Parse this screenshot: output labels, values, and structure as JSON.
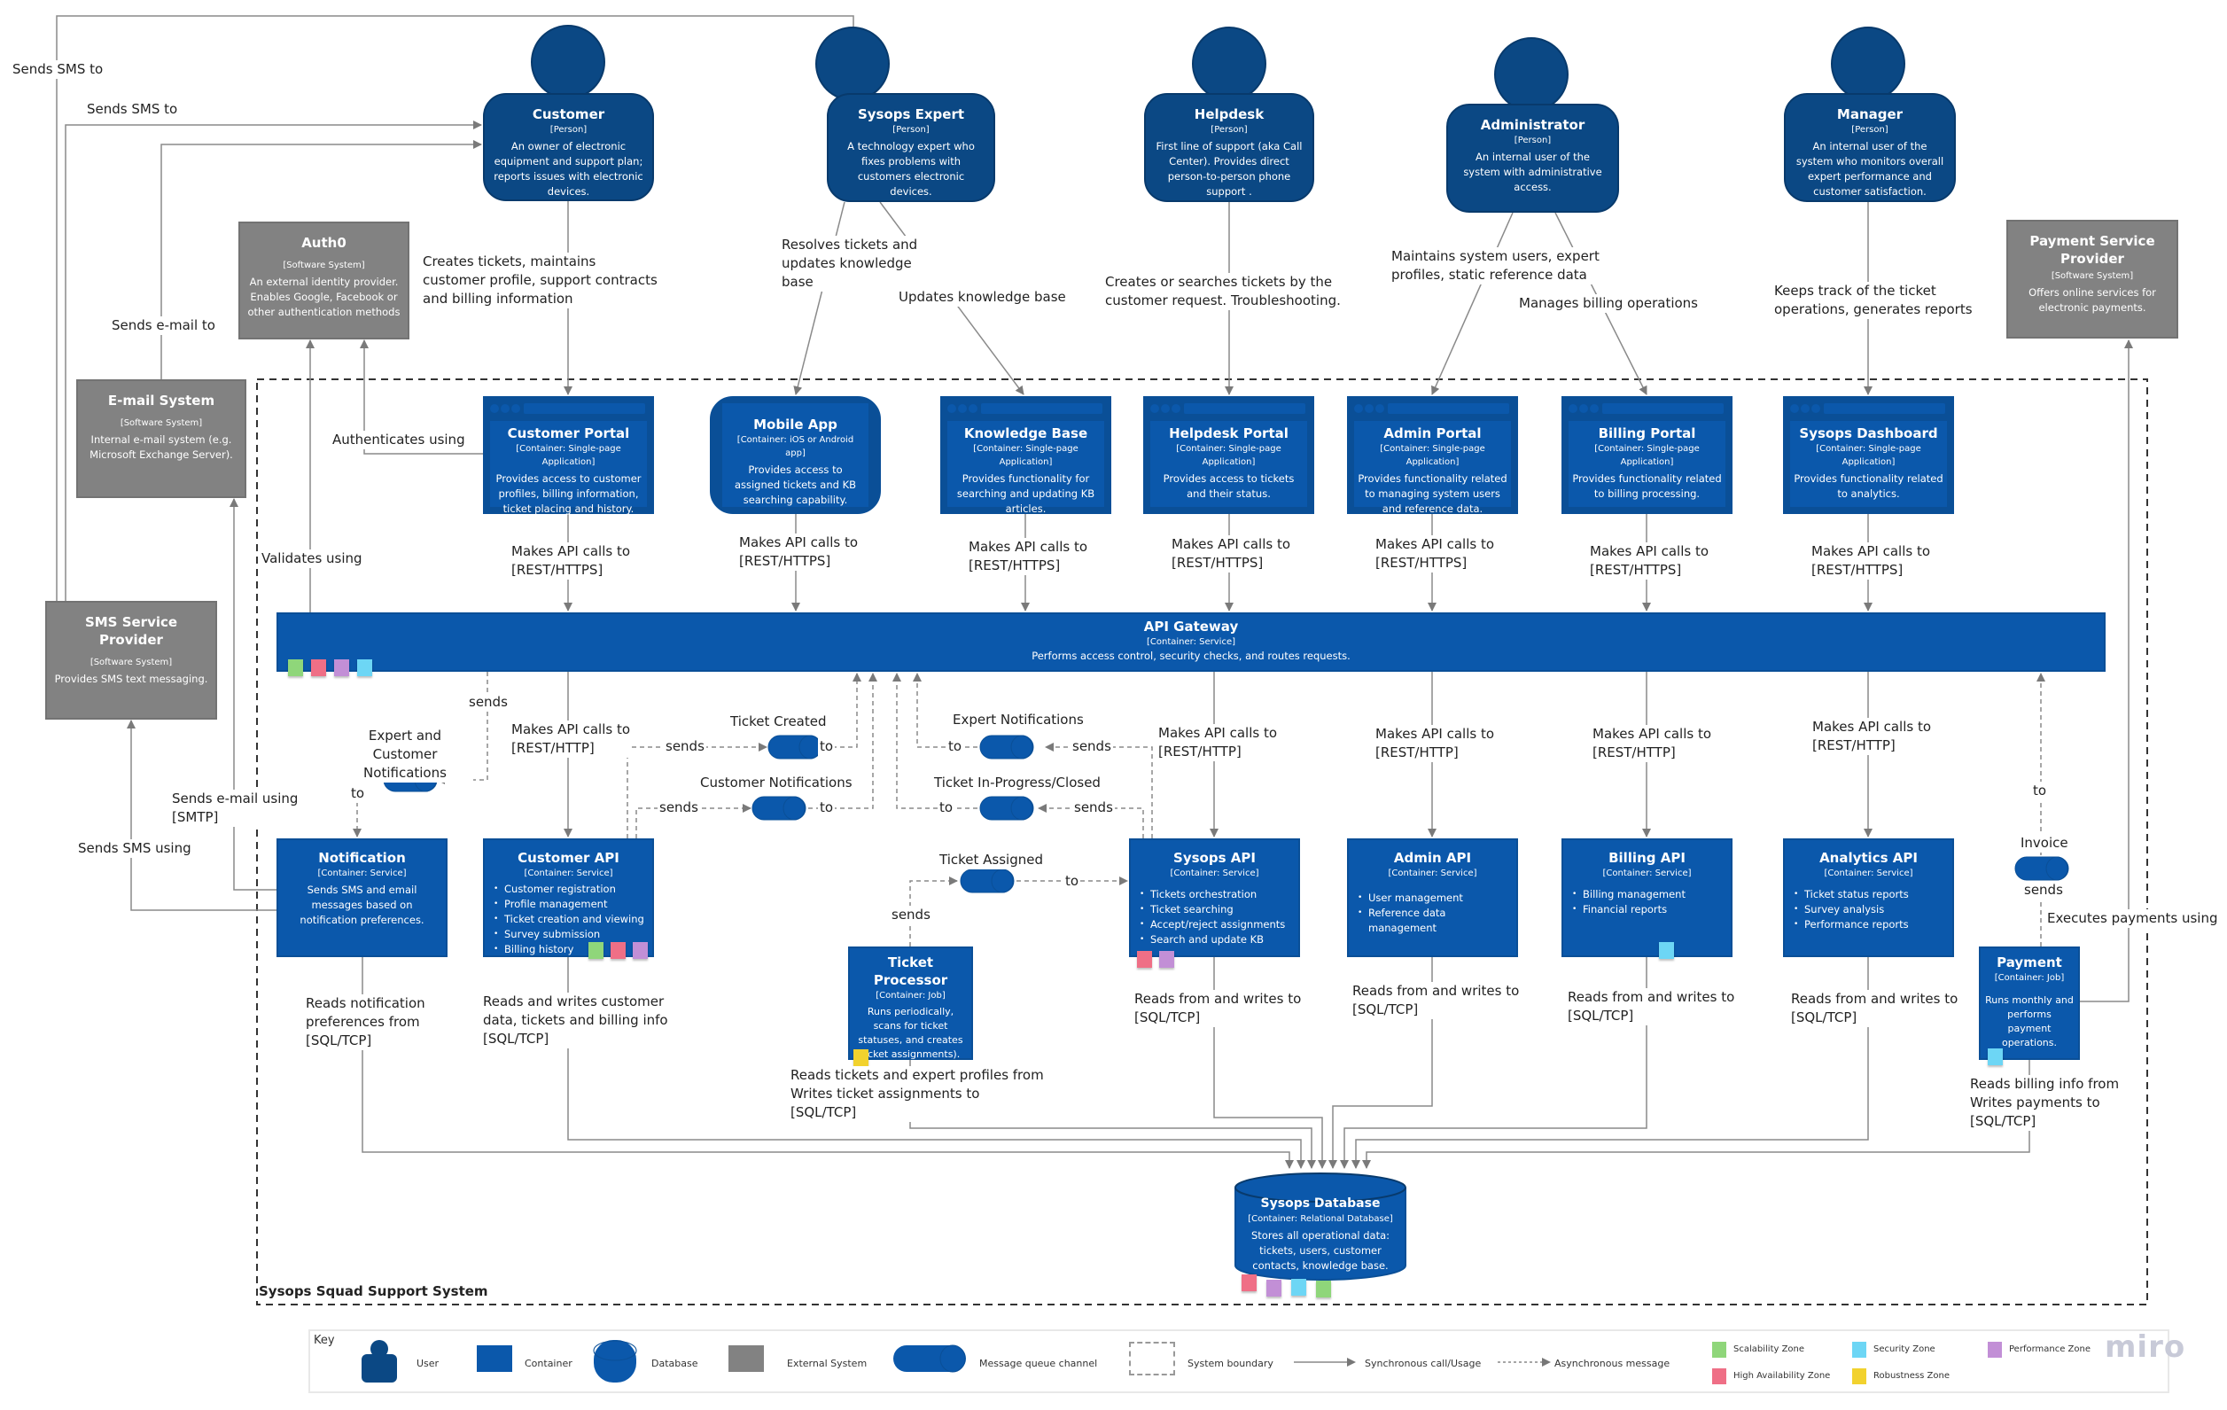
{
  "persons": [
    {
      "id": "customer",
      "name": "Customer",
      "type": "[Person]",
      "desc": "An owner of electronic equipment and support plan; reports issues with electronic devices."
    },
    {
      "id": "sysops-expert",
      "name": "Sysops Expert",
      "type": "[Person]",
      "desc": "A technology expert who fixes problems with customers electronic devices."
    },
    {
      "id": "helpdesk",
      "name": "Helpdesk",
      "type": "[Person]",
      "desc": "First line of support (aka Call Center). Provides direct person-to-person phone support ."
    },
    {
      "id": "administrator",
      "name": "Administrator",
      "type": "[Person]",
      "desc": "An internal user of the system with administrative access."
    },
    {
      "id": "manager",
      "name": "Manager",
      "type": "[Person]",
      "desc": "An internal user of the system who monitors overall expert performance and customer satisfaction."
    }
  ],
  "external_systems": [
    {
      "id": "auth0",
      "name": "Auth0",
      "type": "[Software System]",
      "desc": "An external identity provider. Enables Google, Facebook or other authentication methods"
    },
    {
      "id": "email-system",
      "name": "E-mail System",
      "type": "[Software System]",
      "desc": "Internal e-mail system (e.g. Microsoft Exchange Server)."
    },
    {
      "id": "sms-provider",
      "name": "SMS Service Provider",
      "type": "[Software System]",
      "desc": "Provides SMS text messaging."
    },
    {
      "id": "payment-provider",
      "name": "Payment Service Provider",
      "type": "[Software System]",
      "desc": "Offers online services for electronic payments."
    }
  ],
  "frontends": [
    {
      "id": "customer-portal",
      "name": "Customer Portal",
      "type": "[Container: Single-page Application]",
      "desc": "Provides access to customer profiles,  billing information, ticket placing and history."
    },
    {
      "id": "mobile-app",
      "name": "Mobile App",
      "type": "[Container: iOS or Android app]",
      "desc": "Provides access to assigned tickets and KB searching capability."
    },
    {
      "id": "knowledge-base",
      "name": "Knowledge Base",
      "type": "[Container: Single-page Application]",
      "desc": "Provides functionality for searching and updating KB articles."
    },
    {
      "id": "helpdesk-portal",
      "name": "Helpdesk Portal",
      "type": "[Container: Single-page Application]",
      "desc": "Provides access to tickets and their status."
    },
    {
      "id": "admin-portal",
      "name": "Admin Portal",
      "type": "[Container: Single-page Application]",
      "desc": "Provides functionality related to managing system users and reference data."
    },
    {
      "id": "billing-portal",
      "name": "Billing Portal",
      "type": "[Container: Single-page Application]",
      "desc": "Provides functionality related to billing processing."
    },
    {
      "id": "sysops-dashboard",
      "name": "Sysops Dashboard",
      "type": "[Container: Single-page Application]",
      "desc": "Provides functionality related to analytics."
    }
  ],
  "gateway": {
    "name": "API Gateway",
    "type": "[Container: Service]",
    "desc": "Performs access control, security checks, and routes requests."
  },
  "services": [
    {
      "id": "notification",
      "name": "Notification",
      "type": "[Container: Service]",
      "desc": "Sends SMS and email messages based on notification preferences.",
      "items": []
    },
    {
      "id": "customer-api",
      "name": "Customer API",
      "type": "[Container: Service]",
      "desc": "",
      "items": [
        "Customer registration",
        "Profile management",
        "Ticket creation and viewing",
        "Survey submission",
        "Billing history"
      ]
    },
    {
      "id": "sysops-api",
      "name": "Sysops API",
      "type": "[Container: Service]",
      "desc": "",
      "items": [
        "Tickets orchestration",
        "Ticket searching",
        "Accept/reject assignments",
        "Search and update KB"
      ]
    },
    {
      "id": "admin-api",
      "name": "Admin API",
      "type": "[Container: Service]",
      "desc": "",
      "items": [
        "User management",
        "Reference data management"
      ]
    },
    {
      "id": "billing-api",
      "name": "Billing API",
      "type": "[Container: Service]",
      "desc": "",
      "items": [
        "Billing management",
        "Financial reports"
      ]
    },
    {
      "id": "analytics-api",
      "name": "Analytics API",
      "type": "[Container: Service]",
      "desc": "",
      "items": [
        "Ticket status reports",
        "Survey analysis",
        "Performance reports"
      ]
    }
  ],
  "jobs": [
    {
      "id": "ticket-processor",
      "name": "Ticket Processor",
      "type": "[Container: Job]",
      "desc": "Runs periodically, scans for ticket statuses, and creates ticket assignments)."
    },
    {
      "id": "payment",
      "name": "Payment",
      "type": "[Container: Job]",
      "desc": "Runs monthly and performs payment operations."
    }
  ],
  "database": {
    "name": "Sysops Database",
    "type": "[Container: Relational Database]",
    "desc": "Stores all operational data: tickets, users, customer contacts, knowledge base."
  },
  "queues": [
    {
      "id": "expert-customer-notifications",
      "name": "Expert and Customer Notifications"
    },
    {
      "id": "ticket-created",
      "name": "Ticket Created"
    },
    {
      "id": "customer-notifications",
      "name": "Customer Notifications"
    },
    {
      "id": "expert-notifications",
      "name": "Expert Notifications"
    },
    {
      "id": "ticket-in-progress-closed",
      "name": "Ticket In-Progress/Closed"
    },
    {
      "id": "ticket-assigned",
      "name": "Ticket Assigned"
    },
    {
      "id": "invoice",
      "name": "Invoice"
    }
  ],
  "boundary_label": "Sysops Squad Support System",
  "relations": {
    "sms_to_1": "Sends SMS to",
    "sms_to_2": "Sends SMS to",
    "email_to": "Sends e-mail to",
    "customer_portal": "Creates tickets, maintains customer profile, support contracts and billing information",
    "resolves": "Resolves tickets and updates knowledge base",
    "updates_kb": "Updates knowledge base",
    "helpdesk": "Creates or searches tickets by the customer request. Troubleshooting.",
    "maintains": "Maintains system users, expert profiles, static reference data",
    "manages_billing": "Manages billing operations",
    "keeps_track": "Keeps track of the ticket operations, generates reports",
    "authenticates": "Authenticates using",
    "validates": "Validates using",
    "api_https": "Makes API calls to",
    "api_https_proto": "[REST/HTTPS]",
    "api_http": "Makes API calls to",
    "api_http_proto": "[REST/HTTP]",
    "sends": "sends",
    "to": "to",
    "email_using": "Sends e-mail using",
    "email_using_proto": "[SMTP]",
    "sms_using": "Sends SMS using",
    "executes_payments": "Executes payments using",
    "reads_notif_1": "Reads notification",
    "reads_notif_2": "preferences from",
    "sql_tcp": "[SQL/TCP]",
    "rw_customer_1": "Reads and writes customer",
    "rw_customer_2": "data, tickets and billing info",
    "tp_1": "Reads tickets and expert profiles from",
    "tp_2": "Writes ticket assignments to",
    "rw": "Reads from and writes to",
    "pay_1": "Reads billing info from",
    "pay_2": "Writes payments to"
  },
  "key": {
    "title": "Key",
    "user": "User",
    "container": "Container",
    "database": "Database",
    "external": "External System",
    "queue": "Message queue channel",
    "boundary": "System boundary",
    "sync": "Synchronous call/Usage",
    "async": "Asynchronous message",
    "zones": [
      {
        "name": "Scalability Zone",
        "color": "#8fd67a"
      },
      {
        "name": "Security Zone",
        "color": "#6dd6f5"
      },
      {
        "name": "Performance Zone",
        "color": "#c28fd6"
      },
      {
        "name": "High Availability Zone",
        "color": "#ef6f86"
      },
      {
        "name": "Robustness Zone",
        "color": "#f2d22e"
      }
    ]
  },
  "watermark": "miro",
  "colors": {
    "person": "#0b4884",
    "container": "#0b58ab",
    "external": "#828282",
    "line": "#7a7a7a"
  }
}
